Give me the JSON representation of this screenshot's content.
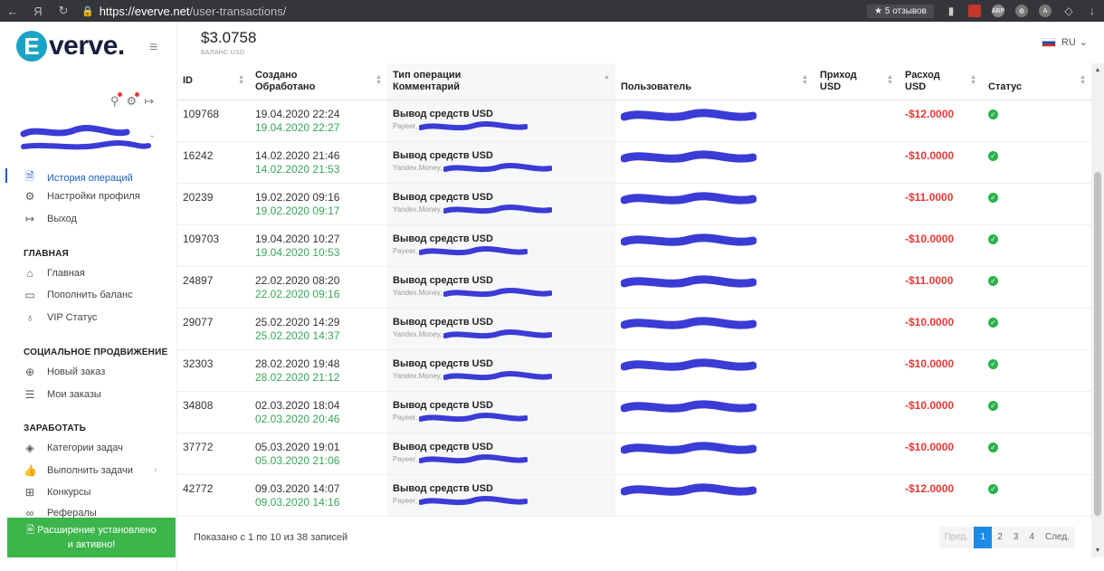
{
  "browser": {
    "back": "←",
    "ya": "Я",
    "reload": "↻",
    "url_host": "https://everve.net",
    "url_path": "/user-transactions/",
    "reviews": "★ 5 отзывов",
    "download": "↓"
  },
  "sidebar": {
    "logo_letter": "E",
    "logo_text": "verve.",
    "menu_icon": "≡",
    "nav_top": [
      {
        "icon": "document-icon",
        "label": "История операций",
        "active": true
      },
      {
        "icon": "settings-icon",
        "label": "Настройки профиля"
      },
      {
        "icon": "logout-icon",
        "label": "Выход"
      }
    ],
    "section_main": "ГЛАВНАЯ",
    "nav_main": [
      {
        "icon": "home-icon",
        "label": "Главная"
      },
      {
        "icon": "card-icon",
        "label": "Пополнить баланс"
      },
      {
        "icon": "vip-icon",
        "label": "VIP Статус"
      }
    ],
    "section_social": "СОЦИАЛЬНОЕ ПРОДВИЖЕНИЕ",
    "nav_social": [
      {
        "icon": "plus-circle-icon",
        "label": "Новый заказ"
      },
      {
        "icon": "list-icon",
        "label": "Мои заказы"
      }
    ],
    "section_earn": "ЗАРАБОТАТЬ",
    "nav_earn": [
      {
        "icon": "layers-icon",
        "label": "Категории задач"
      },
      {
        "icon": "thumb-icon",
        "label": "Выполнить задачи"
      },
      {
        "icon": "gift-icon",
        "label": "Конкурсы"
      },
      {
        "icon": "referral-icon",
        "label": "Рефералы"
      }
    ],
    "extension_banner_line1": "🖹 Расширение установлено",
    "extension_banner_line2": "и активно!"
  },
  "header": {
    "balance": "$3.0758",
    "balance_label": "БАЛАНС USD",
    "lang": "RU",
    "lang_chevron": "⌄"
  },
  "table": {
    "columns": {
      "id": "ID",
      "created": "Создано",
      "processed": "Обработано",
      "type": "Тип операции",
      "comment": "Комментарий",
      "user": "Пользователь",
      "income": "Приход",
      "income_cur": "USD",
      "outcome": "Расход",
      "outcome_cur": "USD",
      "status": "Статус"
    },
    "rows": [
      {
        "id": "109768",
        "created": "19.04.2020 22:24",
        "processed": "19.04.2020 22:27",
        "type": "Вывод средств USD",
        "comment": "Payeer,",
        "outcome": "-$12.0000"
      },
      {
        "id": "16242",
        "created": "14.02.2020 21:46",
        "processed": "14.02.2020 21:53",
        "type": "Вывод средств USD",
        "comment": "Yandex.Money,",
        "outcome": "-$10.0000"
      },
      {
        "id": "20239",
        "created": "19.02.2020 09:16",
        "processed": "19.02.2020 09:17",
        "type": "Вывод средств USD",
        "comment": "Yandex.Money,",
        "outcome": "-$11.0000"
      },
      {
        "id": "109703",
        "created": "19.04.2020 10:27",
        "processed": "19.04.2020 10:53",
        "type": "Вывод средств USD",
        "comment": "Payeer,",
        "outcome": "-$10.0000"
      },
      {
        "id": "24897",
        "created": "22.02.2020 08:20",
        "processed": "22.02.2020 09:16",
        "type": "Вывод средств USD",
        "comment": "Yandex.Money,",
        "outcome": "-$11.0000"
      },
      {
        "id": "29077",
        "created": "25.02.2020 14:29",
        "processed": "25.02.2020 14:37",
        "type": "Вывод средств USD",
        "comment": "Yandex.Money,",
        "outcome": "-$10.0000"
      },
      {
        "id": "32303",
        "created": "28.02.2020 19:48",
        "processed": "28.02.2020 21:12",
        "type": "Вывод средств USD",
        "comment": "Yandex.Money,",
        "outcome": "-$10.0000"
      },
      {
        "id": "34808",
        "created": "02.03.2020 18:04",
        "processed": "02.03.2020 20:46",
        "type": "Вывод средств USD",
        "comment": "Payeer,",
        "outcome": "-$10.0000"
      },
      {
        "id": "37772",
        "created": "05.03.2020 19:01",
        "processed": "05.03.2020 21:06",
        "type": "Вывод средств USD",
        "comment": "Payeer,",
        "outcome": "-$10.0000"
      },
      {
        "id": "42772",
        "created": "09.03.2020 14:07",
        "processed": "09.03.2020 14:16",
        "type": "Вывод средств USD",
        "comment": "Payeer,",
        "outcome": "-$12.0000"
      }
    ]
  },
  "footer": {
    "showing": "Показано с 1 по 10 из 38 записей",
    "prev": "Пред.",
    "pages": [
      "1",
      "2",
      "3",
      "4"
    ],
    "current_page": "1",
    "next": "След."
  },
  "colors": {
    "accent": "#1c8be8",
    "negative": "#e53935",
    "processed": "#3aa55a",
    "status_ok": "#2bb24c",
    "extension_banner": "#3cb54b",
    "redaction": "#3b3bd6"
  }
}
